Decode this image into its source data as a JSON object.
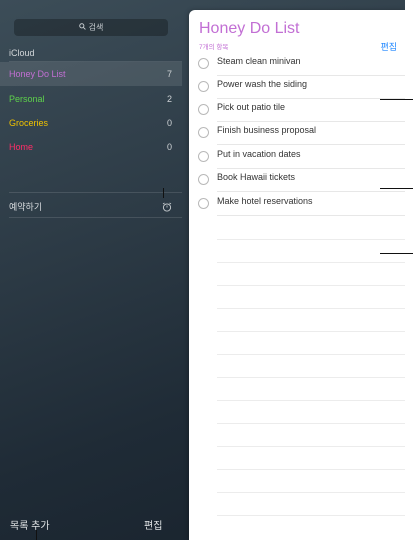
{
  "sidebar": {
    "search_label": "검색",
    "account": "iCloud",
    "lists": [
      {
        "name": "Honey Do List",
        "count": "7",
        "color": "#c26fd4",
        "selected": true
      },
      {
        "name": "Personal",
        "count": "2",
        "color": "#5ed24b"
      },
      {
        "name": "Groceries",
        "count": "0",
        "color": "#f0c200"
      },
      {
        "name": "Home",
        "count": "0",
        "color": "#ff2d68"
      }
    ],
    "scheduled": "예약하기",
    "add_list": "목록 추가",
    "edit": "편집"
  },
  "panel": {
    "title": "Honey Do List",
    "subtitle": "7개의 항목",
    "edit": "편집",
    "tasks": [
      "Steam clean minivan",
      "Power wash the siding",
      "Pick out patio tile",
      "Finish business proposal",
      "Put in vacation dates",
      "Book Hawaii tickets",
      "Make hotel reservations"
    ]
  }
}
